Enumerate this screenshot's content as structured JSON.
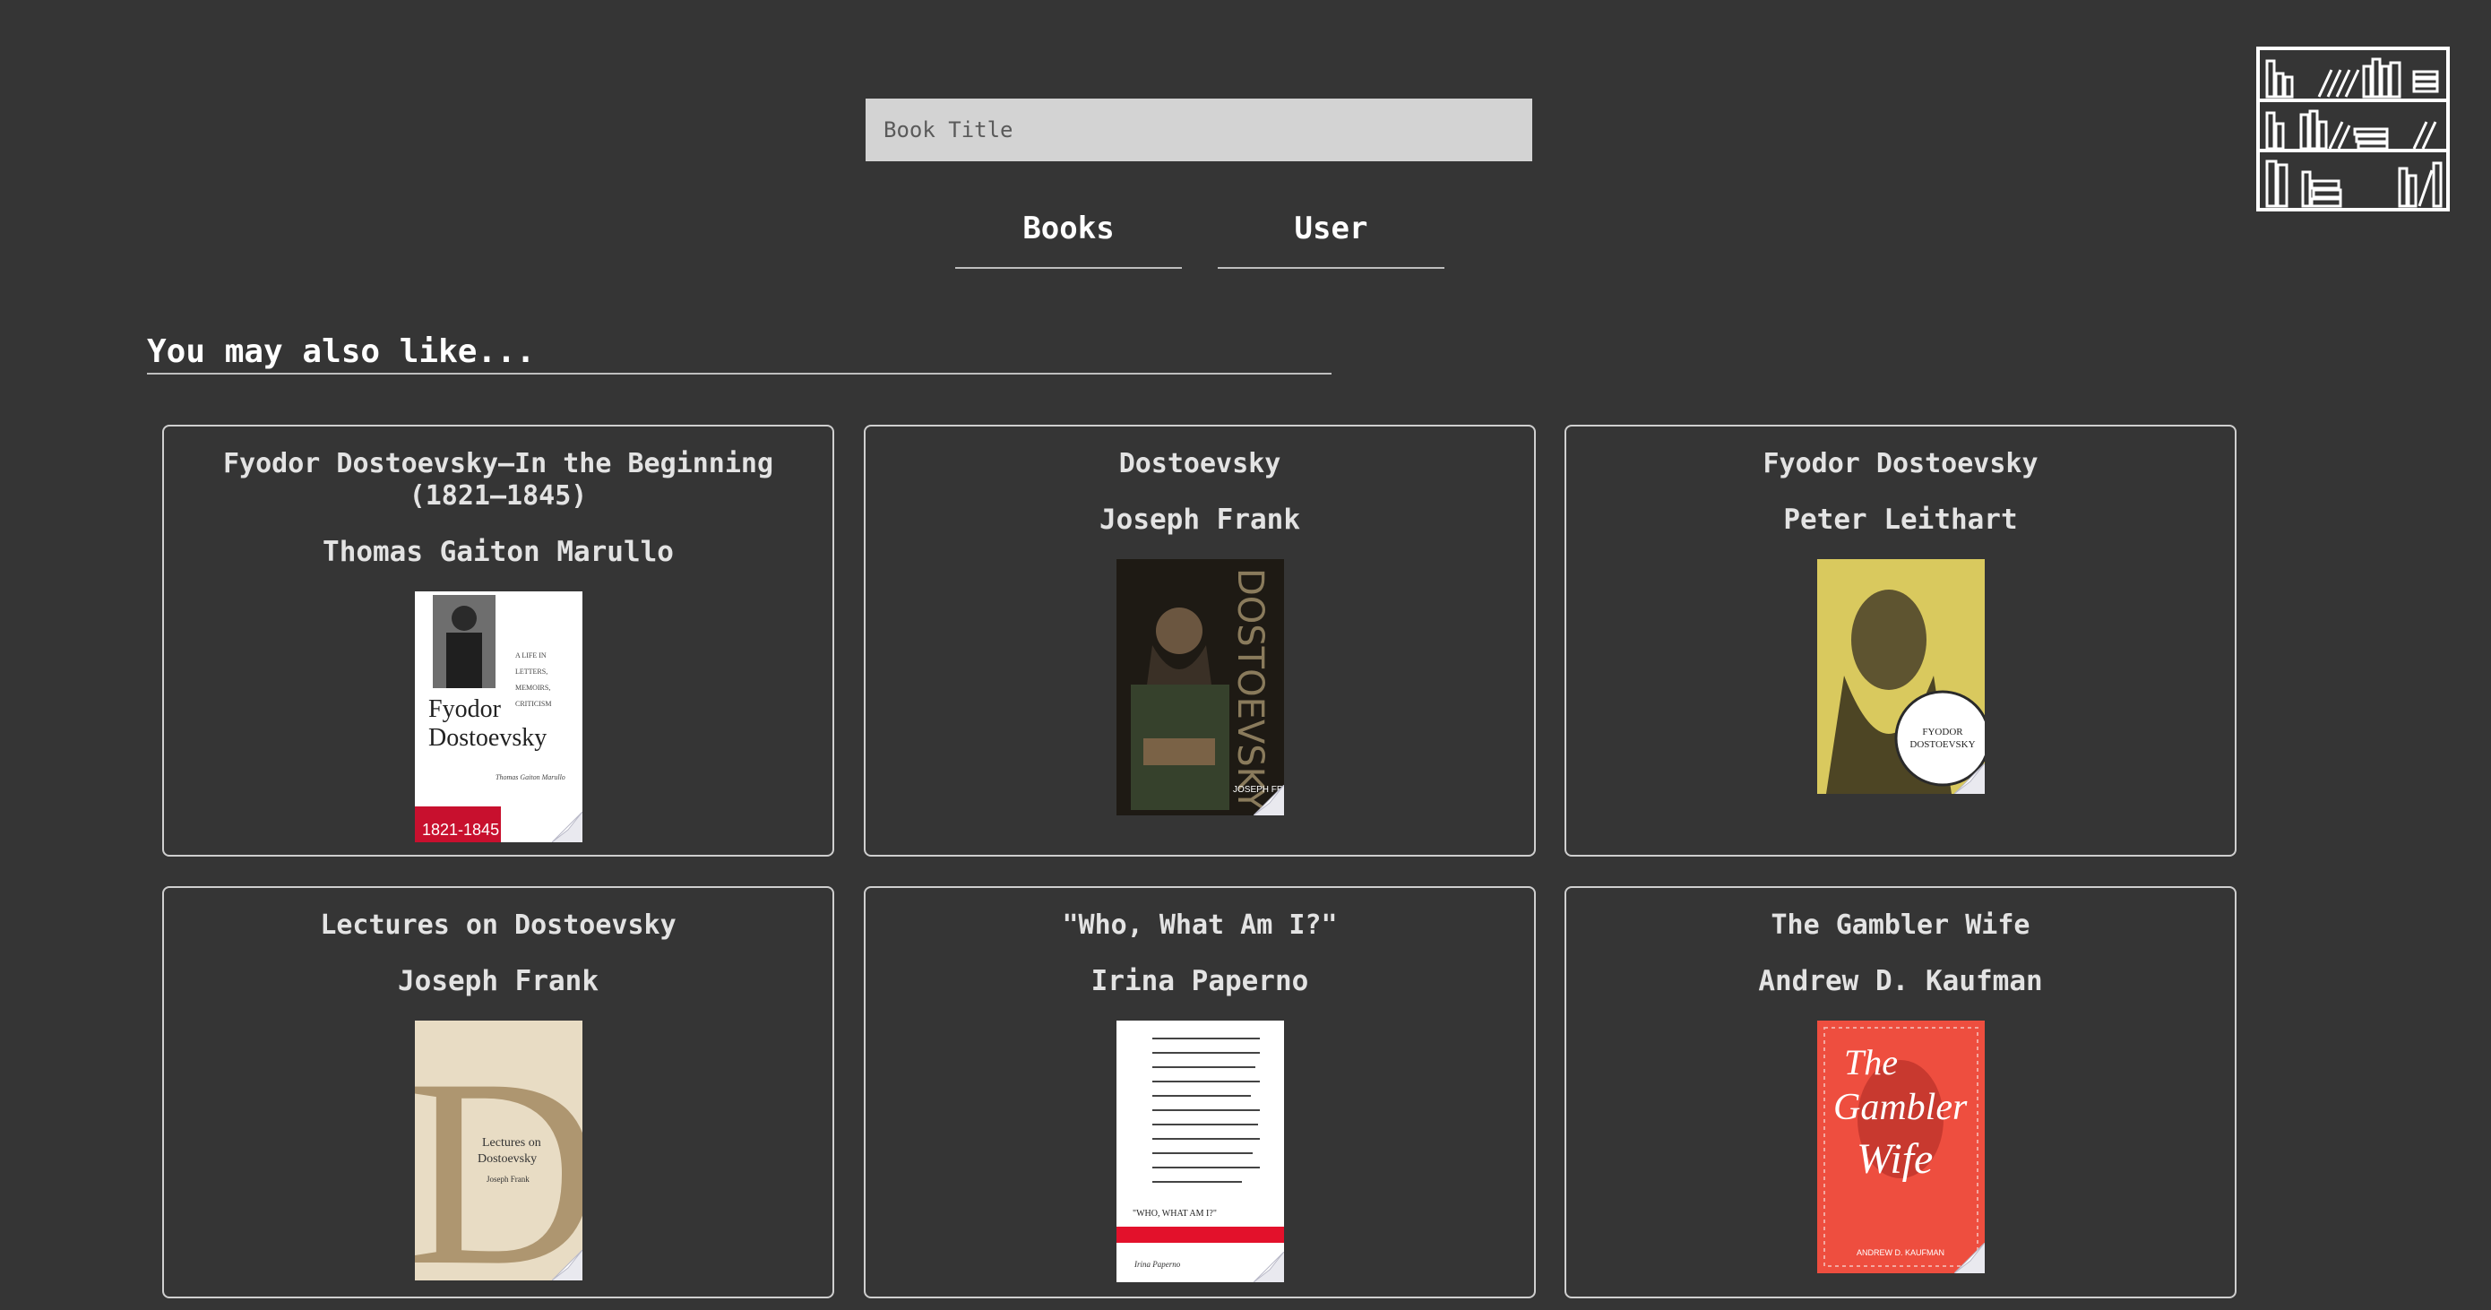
{
  "search": {
    "placeholder": "Book Title"
  },
  "nav": {
    "books_label": "Books",
    "user_label": "User"
  },
  "section": {
    "title": "You may also like..."
  },
  "books": [
    {
      "title": "Fyodor Dostoevsky—In the Beginning (1821–1845)",
      "author": "Thomas Gaiton Marullo",
      "cover_color": "#ffffff",
      "accent": "#c8102e"
    },
    {
      "title": "Dostoevsky",
      "author": "Joseph Frank",
      "cover_color": "#1e1a14",
      "accent": "#8a7b5c"
    },
    {
      "title": "Fyodor Dostoevsky",
      "author": "Peter Leithart",
      "cover_color": "#d9c95e",
      "accent": "#ffffff"
    },
    {
      "title": "Lectures on Dostoevsky",
      "author": "Joseph Frank",
      "cover_color": "#e8dcc4",
      "accent": "#a58a62"
    },
    {
      "title": "\"Who, What Am I?\"",
      "author": "Irina Paperno",
      "cover_color": "#ffffff",
      "accent": "#e3112b"
    },
    {
      "title": "The Gambler Wife",
      "author": "Andrew D. Kaufman",
      "cover_color": "#ee4e3f",
      "accent": "#ffffff"
    }
  ]
}
